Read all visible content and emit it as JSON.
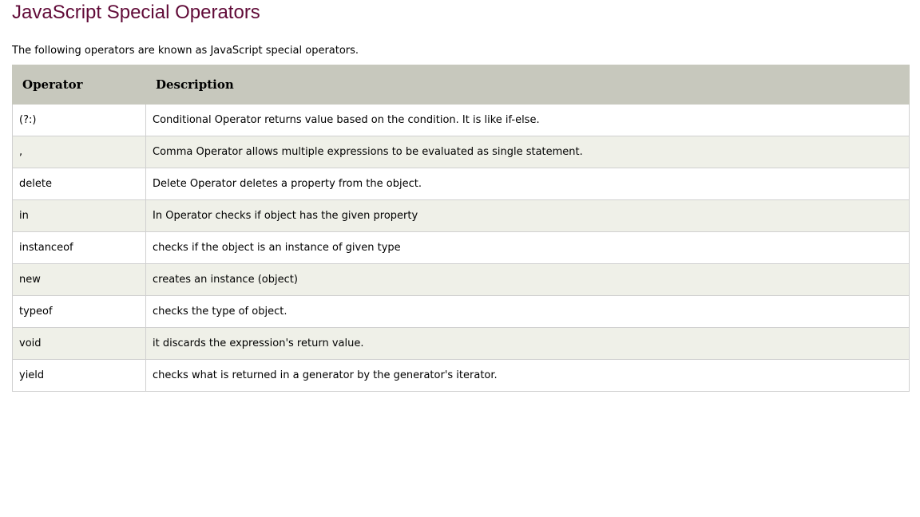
{
  "page_title": "JavaScript Special Operators",
  "intro": "The following operators are known as JavaScript special operators.",
  "table": {
    "headers": [
      "Operator",
      "Description"
    ],
    "rows": [
      {
        "operator": "(?:)",
        "description": "Conditional Operator returns value based on the condition. It is like if-else."
      },
      {
        "operator": ",",
        "description": "Comma Operator allows multiple expressions to be evaluated as single statement."
      },
      {
        "operator": "delete",
        "description": "Delete Operator deletes a property from the object."
      },
      {
        "operator": "in",
        "description": "In Operator checks if object has the given property"
      },
      {
        "operator": "instanceof",
        "description": "checks if the object is an instance of given type"
      },
      {
        "operator": "new",
        "description": "creates an instance (object)"
      },
      {
        "operator": "typeof",
        "description": "checks the type of object."
      },
      {
        "operator": "void",
        "description": "it discards the expression's return value."
      },
      {
        "operator": "yield",
        "description": "checks what is returned in a generator by the generator's iterator."
      }
    ]
  },
  "colors": {
    "title": "#610b38",
    "header_bg": "#c7c8bd",
    "alt_row_bg": "#eff0e8"
  }
}
